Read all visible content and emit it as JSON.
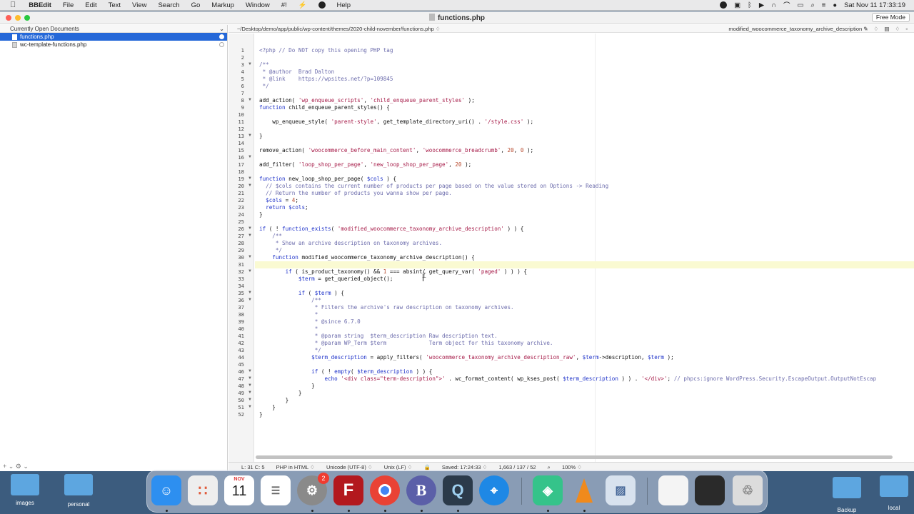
{
  "menubar": {
    "app": "BBEdit",
    "items": [
      "File",
      "Edit",
      "Text",
      "View",
      "Search",
      "Go",
      "Markup",
      "Window",
      "#!"
    ],
    "help": "Help",
    "clock": "Sat Nov 11  17:33:19"
  },
  "window": {
    "title": "functions.php",
    "free_mode": "Free Mode"
  },
  "sidebar": {
    "header": "Currently Open Documents",
    "files": [
      {
        "name": "functions.php",
        "active": true
      },
      {
        "name": "wc-template-functions.php",
        "active": false
      }
    ],
    "footer": "+ ⌄   ⚙ ⌄"
  },
  "pathbar": {
    "path": "~/Desktop/demo/app/public/wp-content/themes/2020-child-november/functions.php ♢",
    "function": "modified_woocommerce_taxonomy_archive_description ♢",
    "tools": "✎ ♢ ▤ ♢ ▫"
  },
  "status": {
    "position": "L: 31 C: 5",
    "language": "PHP in HTML ♢",
    "encoding": "Unicode (UTF-8) ♢",
    "line_endings": "Unix (LF) ♢",
    "saved": "Saved: 17:24:33 ♢",
    "counts": "1,663 / 137 / 52",
    "zoom": "100% ♢"
  },
  "desktop": {
    "folders": [
      "images",
      "personal",
      "Backup",
      "local"
    ]
  },
  "dock": {
    "calendar_month": "NOV",
    "calendar_day": "11",
    "badge": "2",
    "apps": [
      "finder",
      "launchpad",
      "calendar",
      "reminders",
      "system-settings",
      "filezilla",
      "chrome",
      "bbedit",
      "quicktime",
      "safari",
      "local",
      "vlc",
      "preview",
      "screenshot-1",
      "screenshot-2",
      "trash"
    ]
  },
  "code": {
    "fold_lines": [
      3,
      8,
      13,
      16,
      19,
      20,
      26,
      27,
      30,
      32,
      35,
      36,
      46,
      47,
      48,
      49,
      50,
      51
    ],
    "current_line": 31,
    "lines": [
      [
        [
          "cm",
          "<?php // Do NOT copy this opening PHP tag"
        ]
      ],
      [],
      [
        [
          "cm",
          "/**"
        ]
      ],
      [
        [
          "cm",
          " * @author  Brad Dalton"
        ]
      ],
      [
        [
          "cm",
          " * @link    https://wpsites.net/?p=109845"
        ]
      ],
      [
        [
          "cm",
          " */"
        ]
      ],
      [],
      [
        [
          "t",
          "add_action( "
        ],
        [
          "str",
          "'wp_enqueue_scripts'"
        ],
        [
          "t",
          ", "
        ],
        [
          "str",
          "'child_enqueue_parent_styles'"
        ],
        [
          "t",
          " );"
        ]
      ],
      [
        [
          "kw",
          "function"
        ],
        [
          "t",
          " child_enqueue_parent_styles() {"
        ]
      ],
      [],
      [
        [
          "t",
          "    wp_enqueue_style( "
        ],
        [
          "str",
          "'parent-style'"
        ],
        [
          "t",
          ", get_template_directory_uri() . "
        ],
        [
          "str",
          "'/style.css'"
        ],
        [
          "t",
          " );"
        ]
      ],
      [],
      [
        [
          "t",
          "}"
        ]
      ],
      [],
      [
        [
          "t",
          "remove_action( "
        ],
        [
          "str",
          "'woocommerce_before_main_content'"
        ],
        [
          "t",
          ", "
        ],
        [
          "str",
          "'woocommerce_breadcrumb'"
        ],
        [
          "t",
          ", "
        ],
        [
          "num",
          "20"
        ],
        [
          "t",
          ", "
        ],
        [
          "num",
          "0"
        ],
        [
          "t",
          " );"
        ]
      ],
      [],
      [
        [
          "t",
          "add_filter( "
        ],
        [
          "str",
          "'loop_shop_per_page'"
        ],
        [
          "t",
          ", "
        ],
        [
          "str",
          "'new_loop_shop_per_page'"
        ],
        [
          "t",
          ", "
        ],
        [
          "num",
          "20"
        ],
        [
          "t",
          " );"
        ]
      ],
      [],
      [
        [
          "kw",
          "function"
        ],
        [
          "t",
          " new_loop_shop_per_page( "
        ],
        [
          "var",
          "$cols"
        ],
        [
          "t",
          " ) {"
        ]
      ],
      [
        [
          "cm",
          "  // $cols contains the current number of products per page based on the value stored on Options -> Reading"
        ]
      ],
      [
        [
          "cm",
          "  // Return the number of products you wanna show per page."
        ]
      ],
      [
        [
          "t",
          "  "
        ],
        [
          "var",
          "$cols"
        ],
        [
          "t",
          " = "
        ],
        [
          "num",
          "4"
        ],
        [
          "t",
          ";"
        ]
      ],
      [
        [
          "t",
          "  "
        ],
        [
          "kw",
          "return"
        ],
        [
          "t",
          " "
        ],
        [
          "var",
          "$cols"
        ],
        [
          "t",
          ";"
        ]
      ],
      [
        [
          "t",
          "}"
        ]
      ],
      [],
      [
        [
          "kw",
          "if"
        ],
        [
          "t",
          " ( ! "
        ],
        [
          "kw",
          "function_exists"
        ],
        [
          "t",
          "( "
        ],
        [
          "str",
          "'modified_woocommerce_taxonomy_archive_description'"
        ],
        [
          "t",
          " ) ) {"
        ]
      ],
      [
        [
          "cm",
          "    /**"
        ]
      ],
      [
        [
          "cm",
          "     * Show an archive description on taxonomy archives."
        ]
      ],
      [
        [
          "cm",
          "     */"
        ]
      ],
      [
        [
          "t",
          "    "
        ],
        [
          "kw",
          "function"
        ],
        [
          "t",
          " modified_woocommerce_taxonomy_archive_description() {"
        ]
      ],
      [],
      [
        [
          "t",
          "        "
        ],
        [
          "kw",
          "if"
        ],
        [
          "t",
          " ( is_product_taxonomy() && "
        ],
        [
          "num",
          "1"
        ],
        [
          "t",
          " === absint( get_query_var( "
        ],
        [
          "str",
          "'paged'"
        ],
        [
          "t",
          " ) ) ) {"
        ]
      ],
      [
        [
          "t",
          "            "
        ],
        [
          "var",
          "$term"
        ],
        [
          "t",
          " = get_queried_object();"
        ]
      ],
      [],
      [
        [
          "t",
          "            "
        ],
        [
          "kw",
          "if"
        ],
        [
          "t",
          " ( "
        ],
        [
          "var",
          "$term"
        ],
        [
          "t",
          " ) {"
        ]
      ],
      [
        [
          "cm",
          "                /**"
        ]
      ],
      [
        [
          "cm",
          "                 * Filters the archive's raw description on taxonomy archives."
        ]
      ],
      [
        [
          "cm",
          "                 *"
        ]
      ],
      [
        [
          "cm",
          "                 * @since 6.7.0"
        ]
      ],
      [
        [
          "cm",
          "                 *"
        ]
      ],
      [
        [
          "cm",
          "                 * @param string  $term_description Raw description text."
        ]
      ],
      [
        [
          "cm",
          "                 * @param WP_Term $term             Term object for this taxonomy archive."
        ]
      ],
      [
        [
          "cm",
          "                 */"
        ]
      ],
      [
        [
          "t",
          "                "
        ],
        [
          "var",
          "$term_description"
        ],
        [
          "t",
          " = apply_filters( "
        ],
        [
          "str",
          "'woocommerce_taxonomy_archive_description_raw'"
        ],
        [
          "t",
          ", "
        ],
        [
          "var",
          "$term"
        ],
        [
          "t",
          "->description, "
        ],
        [
          "var",
          "$term"
        ],
        [
          "t",
          " );"
        ]
      ],
      [],
      [
        [
          "t",
          "                "
        ],
        [
          "kw",
          "if"
        ],
        [
          "t",
          " ( ! "
        ],
        [
          "kw",
          "empty"
        ],
        [
          "t",
          "( "
        ],
        [
          "var",
          "$term_description"
        ],
        [
          "t",
          " ) ) {"
        ]
      ],
      [
        [
          "t",
          "                    "
        ],
        [
          "kw",
          "echo"
        ],
        [
          "t",
          " "
        ],
        [
          "str",
          "'<div class=\"term-description\">'"
        ],
        [
          "t",
          " . wc_format_content( wp_kses_post( "
        ],
        [
          "var",
          "$term_description"
        ],
        [
          "t",
          " ) ) . "
        ],
        [
          "str",
          "'</div>'"
        ],
        [
          "t",
          "; "
        ],
        [
          "cm",
          "// phpcs:ignore WordPress.Security.EscapeOutput.OutputNotEscap"
        ]
      ],
      [
        [
          "t",
          "                }"
        ]
      ],
      [
        [
          "t",
          "            }"
        ]
      ],
      [
        [
          "t",
          "        }"
        ]
      ],
      [
        [
          "t",
          "    }"
        ]
      ],
      [
        [
          "t",
          "}"
        ]
      ]
    ]
  }
}
